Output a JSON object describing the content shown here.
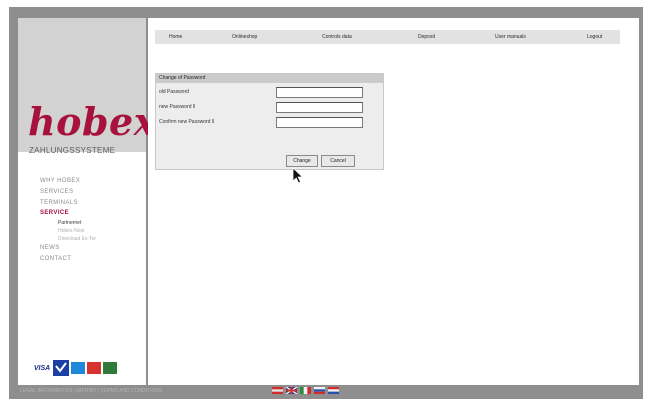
{
  "sidebar": {
    "logo_main": "hobex",
    "logo_sub": "ZAHLUNGSSYSTEME",
    "nav": [
      {
        "label": "WHY HOBEX",
        "active": false
      },
      {
        "label": "SERVICES",
        "active": false
      },
      {
        "label": "TERMINALS",
        "active": false
      },
      {
        "label": "SERVICE",
        "active": true
      }
    ],
    "subnav": [
      {
        "label": "Partnernet",
        "active": true
      },
      {
        "label": "Hobex-Nost",
        "active": false
      },
      {
        "label": "Download Ex-Ter",
        "active": false
      }
    ],
    "nav_after": [
      {
        "label": "NEWS",
        "active": false
      },
      {
        "label": "CONTACT",
        "active": false
      }
    ],
    "cards": [
      "VISA",
      "V PAY",
      "Maestro",
      "MasterCard",
      "JCB"
    ]
  },
  "topnav": [
    "Home",
    "Onlineshop",
    "Controls data",
    "Deposit",
    "User manuals",
    "Logout"
  ],
  "password_form": {
    "title": "Change of Password",
    "fields": [
      {
        "label": "old Password",
        "value": ""
      },
      {
        "label": "new Password ll",
        "value": ""
      },
      {
        "label": "Confirm new Password ll",
        "value": ""
      }
    ],
    "change_label": "Change",
    "cancel_label": "Cancel"
  },
  "footer": {
    "text": "LEGAL INFORMATION | IMPRINT | TERMS AND CONDITIONS",
    "flags": [
      "at",
      "gb",
      "it",
      "si",
      "hr"
    ]
  },
  "colors": {
    "brand": "#a6113d",
    "frame": "#8e8e8e",
    "logo_bg": "#d2d2d2",
    "panel_bg": "#ededed",
    "topnav_bg": "#e2e2e2"
  }
}
